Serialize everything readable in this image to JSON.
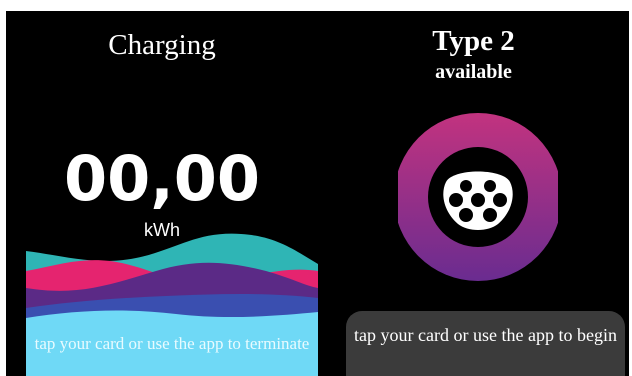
{
  "charging": {
    "title": "Charging",
    "energy_value": "00,00",
    "energy_unit": "kWh",
    "message": "tap your card or use the app to terminate"
  },
  "connector": {
    "type": "Type 2",
    "status": "available",
    "message": "tap your card or use the app to begin"
  },
  "colors": {
    "background": "#000000",
    "wave_cyan": "#6fd9f6",
    "wave_teal": "#2fb5b5",
    "wave_pink": "#e5246f",
    "wave_purple": "#5b2a86",
    "ring_gradient": [
      "#c2337f",
      "#6a2c90"
    ],
    "button_bg": "#3b3b3b"
  },
  "icons": [
    "type2-connector-icon"
  ]
}
